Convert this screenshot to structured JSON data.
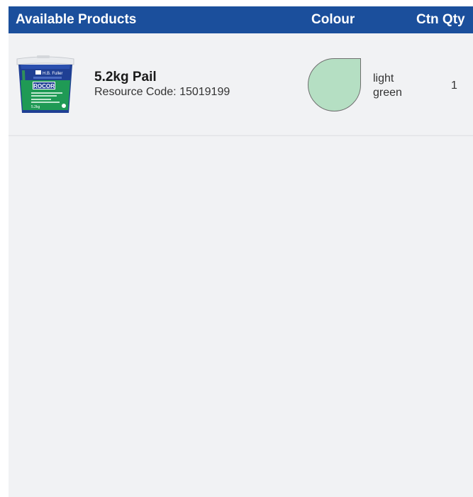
{
  "table": {
    "headers": {
      "products": "Available Products",
      "colour": "Colour",
      "qty": "Ctn Qty"
    },
    "rows": [
      {
        "name": "5.2kg Pail",
        "code": "Resource Code: 15019199",
        "colour_name": "light green",
        "colour_hex": "#b5dfc3",
        "qty": "1",
        "image": {
          "icon": "product-pail-image",
          "brand": "H.B. Fuller",
          "product": "ROCOR",
          "size": "5.2kg"
        }
      }
    ]
  },
  "colors": {
    "header_bg": "#1b4f9c",
    "panel_bg": "#f1f2f4"
  }
}
